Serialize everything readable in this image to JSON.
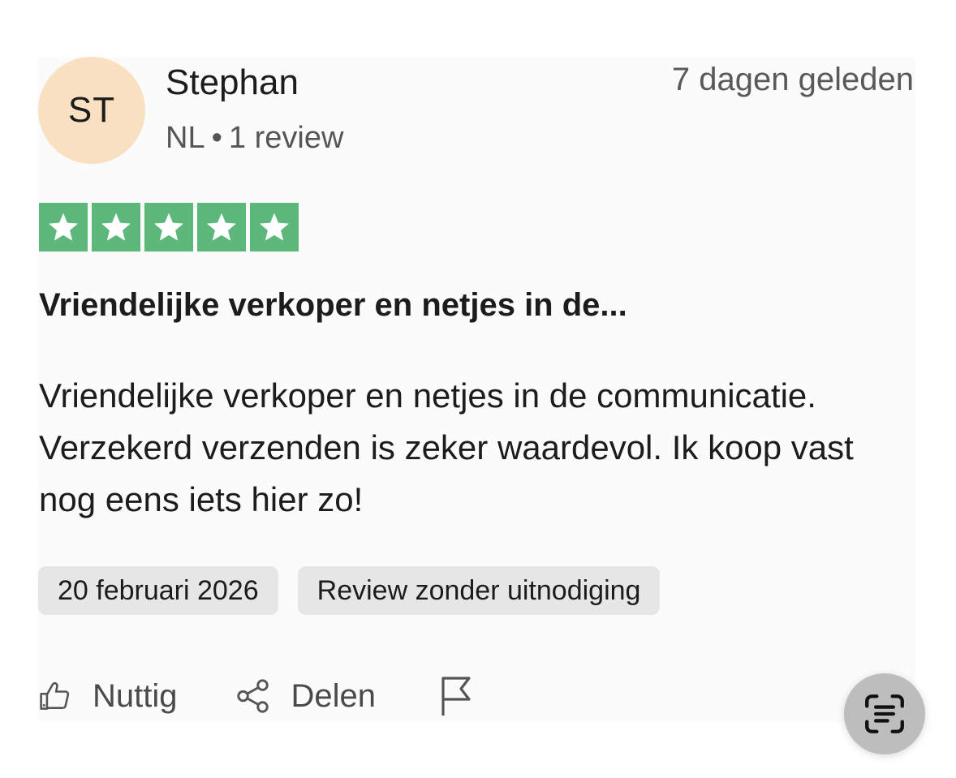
{
  "review": {
    "avatar_initials": "ST",
    "reviewer_name": "Stephan",
    "country": "NL",
    "separator": "•",
    "review_count": "1 review",
    "time_ago": "7 dagen geleden",
    "rating": 5,
    "rating_max": 5,
    "title": "Vriendelijke verkoper en netjes in de...",
    "body": "Vriendelijke verkoper en netjes in de communicatie. Verzekerd verzenden is zeker waardevol. Ik koop vast nog eens iets hier zo!",
    "date_tag": "20 februari 2026",
    "source_tag": "Review zonder uitnodiging"
  },
  "actions": {
    "useful_label": "Nuttig",
    "share_label": "Delen"
  },
  "icons": {
    "useful": "thumbs-up-icon",
    "share": "share-icon",
    "report": "flag-icon",
    "scan": "text-scan-icon",
    "star": "star-icon"
  },
  "colors": {
    "star_green": "#5bb87a",
    "avatar_bg": "#f8e0c0",
    "tag_bg": "#e6e6e6"
  }
}
